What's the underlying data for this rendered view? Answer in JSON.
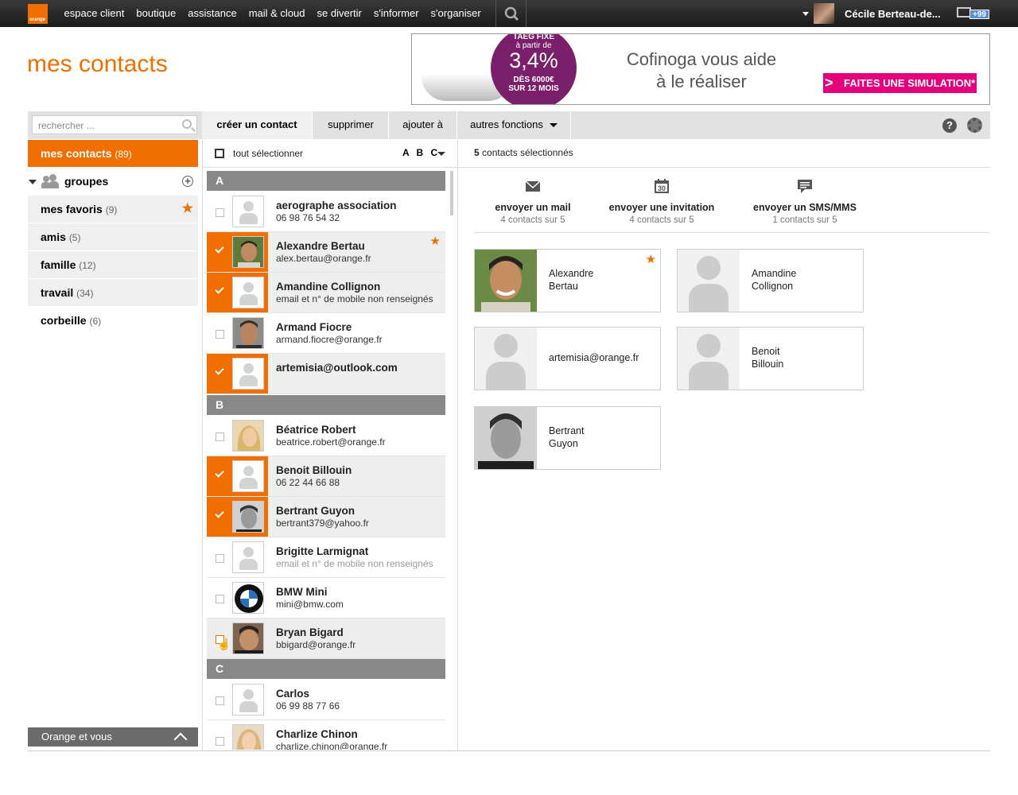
{
  "nav": {
    "logo_text": "orange",
    "items": [
      "espace client",
      "boutique",
      "assistance",
      "mail & cloud",
      "se divertir",
      "s'informer",
      "s'organiser"
    ],
    "user_name": "Cécile Berteau-de...",
    "mail_badge": "+99"
  },
  "page": {
    "title": "mes contacts"
  },
  "ad": {
    "taeg": "TAEG FIXE",
    "partir": "à partir de",
    "rate": "3,4%",
    "des": "DÈS 6000€",
    "sur": "SUR 12 MOIS",
    "text_line1": "Cofinoga vous aide",
    "text_line2": "à le réaliser",
    "button": "FAITES UNE SIMULATION*",
    "button_arrow": ">"
  },
  "toolbar": {
    "search_placeholder": "rechercher ...",
    "create": "créer un contact",
    "delete": "supprimer",
    "add_to": "ajouter à",
    "more": "autres fonctions",
    "help": "?"
  },
  "sidebar": {
    "my_contacts": {
      "label": "mes contacts",
      "count": "(89)"
    },
    "groups_label": "groupes",
    "groups": [
      {
        "label": "mes favoris",
        "count": "(9)"
      },
      {
        "label": "amis",
        "count": "(5)"
      },
      {
        "label": "famille",
        "count": "(12)"
      },
      {
        "label": "travail",
        "count": "(34)"
      }
    ],
    "trash": {
      "label": "corbeille",
      "count": "(6)"
    },
    "footer": "Orange et vous"
  },
  "list": {
    "select_all": "tout sélectionner",
    "sort": "A B C",
    "letters": [
      "A",
      "B",
      "C"
    ],
    "contacts": [
      {
        "name": "aerographe association",
        "sub": "06 98 76 54 32",
        "selected": false
      },
      {
        "name": "Alexandre Bertau",
        "sub": "alex.bertau@orange.fr",
        "selected": true,
        "favorite": true
      },
      {
        "name": "Amandine Collignon",
        "sub": "email et n° de mobile non renseignés",
        "selected": true
      },
      {
        "name": "Armand Fiocre",
        "sub": "armand.fiocre@orange.fr",
        "selected": false
      },
      {
        "name": "artemisia@outlook.com",
        "sub": "",
        "selected": true
      },
      {
        "name": "Béatrice Robert",
        "sub": "beatrice.robert@orange.fr",
        "selected": false
      },
      {
        "name": "Benoit Billouin",
        "sub": "06 22 44 66 88",
        "selected": true
      },
      {
        "name": "Bertrant Guyon",
        "sub": "bertrant379@yahoo.fr",
        "selected": true
      },
      {
        "name": "Brigitte Larmignat",
        "sub": "email et n° de mobile non renseignés",
        "selected": false
      },
      {
        "name": "BMW Mini",
        "sub": "mini@bmw.com",
        "selected": false
      },
      {
        "name": "Bryan Bigard",
        "sub": "bbigard@orange.fr",
        "selected": false
      },
      {
        "name": "Carlos",
        "sub": "06 99 88 77 66",
        "selected": false
      },
      {
        "name": "Charlize Chinon",
        "sub": "charlize.chinon@orange.fr",
        "selected": false
      }
    ]
  },
  "detail": {
    "count_num": "5",
    "count_text": "contacts sélectionnés",
    "actions": [
      {
        "label": "envoyer un mail",
        "sub": "4 contacts sur 5"
      },
      {
        "label": "envoyer une invitation",
        "sub": "4 contacts sur 5",
        "cal_day": "30"
      },
      {
        "label": "envoyer un SMS/MMS",
        "sub": "1 contacts sur 5"
      }
    ],
    "cards": [
      {
        "line1": "Alexandre",
        "line2": "Bertau"
      },
      {
        "line1": "Amandine",
        "line2": "Collignon"
      },
      {
        "line1": "artemisia@orange.fr",
        "line2": ""
      },
      {
        "line1": "Benoit",
        "line2": "Billouin"
      },
      {
        "line1": "Bertrant",
        "line2": "Guyon"
      }
    ]
  },
  "colors": {
    "accent": "#f16e00",
    "topbar": "#222222",
    "ad_purple": "#7b1f6a",
    "ad_pink": "#e4007c",
    "badge": "#5a8ed6"
  }
}
